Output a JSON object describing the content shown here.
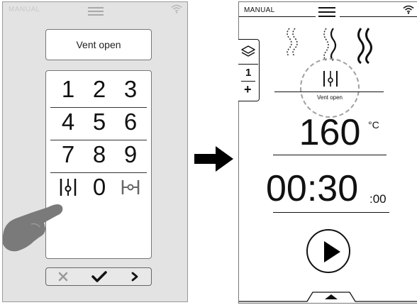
{
  "left_screen": {
    "mode_label": "MANUAL",
    "display_text": "Vent open",
    "keys": [
      "1",
      "2",
      "3",
      "4",
      "5",
      "6",
      "7",
      "8",
      "9",
      "0"
    ]
  },
  "right_screen": {
    "mode_label": "MANUAL",
    "side_tab": {
      "number": "1",
      "plus": "+"
    },
    "vent_label": "Vent open",
    "temperature": "160",
    "temperature_unit": "°C",
    "timer": "00:30",
    "timer_seconds": ":00"
  },
  "icons": {
    "vent_closed": "vent-closed-icon",
    "vent_open": "vent-open-icon",
    "cancel": "cancel-icon",
    "confirm": "checkmark-icon",
    "next": "chevron-right-icon",
    "play": "play-icon",
    "steam": "steam-icon",
    "layers": "layers-icon",
    "wifi": "wifi-icon",
    "menu": "menu-icon",
    "hand": "hand-pointer-icon",
    "arrow": "arrow-right-icon"
  },
  "colors": {
    "left_background": "#e3e3e3",
    "vent_circle": "#a0a0a0",
    "hand": "#7a7a7a"
  }
}
